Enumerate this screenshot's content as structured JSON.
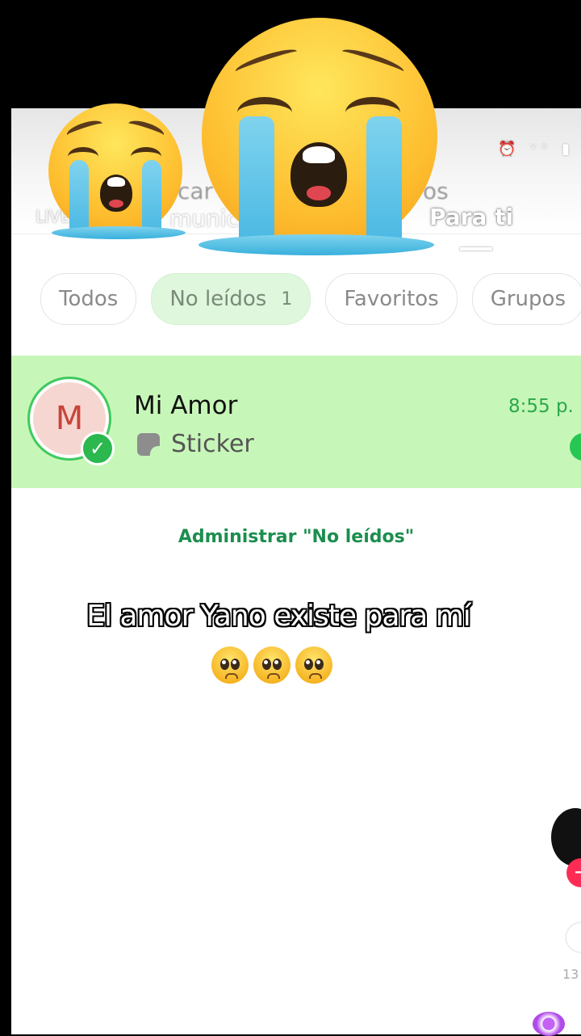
{
  "header": {
    "tab_left_fragment_1": "car",
    "tab_left_fragment_2": "munic",
    "tab_right_fragment": "os",
    "active_tab": "Para ti",
    "live_badge": "LIVE",
    "status_icons": "⏰ ᵛᵒ ▮"
  },
  "filters": [
    {
      "label": "Todos",
      "active": false
    },
    {
      "label": "No leídos",
      "count": "1",
      "active": true
    },
    {
      "label": "Favoritos",
      "active": false
    },
    {
      "label": "Grupos",
      "active": false
    }
  ],
  "chat": {
    "avatar_letter": "M",
    "name": "Mi Amor",
    "preview": "Sticker",
    "time": "8:55 p.",
    "highlight_color": "#c7f7b8"
  },
  "manage_link": "Administrar \"No leídos\"",
  "caption": {
    "text": "El amor Yano existe para mí",
    "emoji_count": 3,
    "emoji": "pleading-face"
  },
  "overlay_emoji": "loudly-crying-face",
  "side_rail": {
    "plus": "+",
    "count": "13"
  },
  "colors": {
    "accent_green": "#1b8e4e",
    "time_green": "#2aa84b",
    "avatar_bg": "#f6d6d0",
    "avatar_letter": "#c6443a"
  }
}
